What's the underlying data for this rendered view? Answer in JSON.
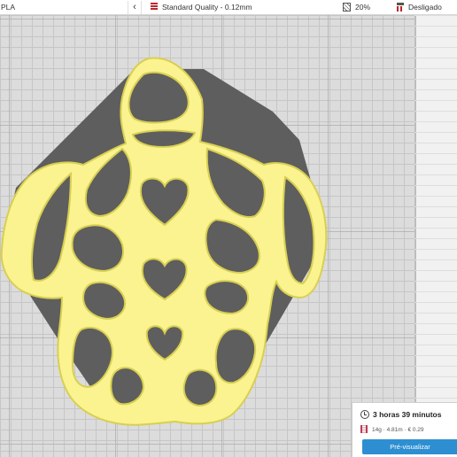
{
  "topbar": {
    "material": "PLA",
    "collapse_icon": "chevron-left-icon",
    "quality_label": "Standard Quality - 0.12mm",
    "infill_label": "20%",
    "support_label": "Desligado"
  },
  "print_panel": {
    "time": "3 horas 39 minutos",
    "material_usage": "14g · 4.81m · € 0.29",
    "preview_button": "Pré-visualizar"
  },
  "colors": {
    "model_fill": "#faf38f",
    "model_outline": "#d8cf52",
    "hole_fill": "#585858",
    "buildplate": "#dcdcdc",
    "accent": "#2d8fd1",
    "quality_icon": "#c0262c"
  }
}
